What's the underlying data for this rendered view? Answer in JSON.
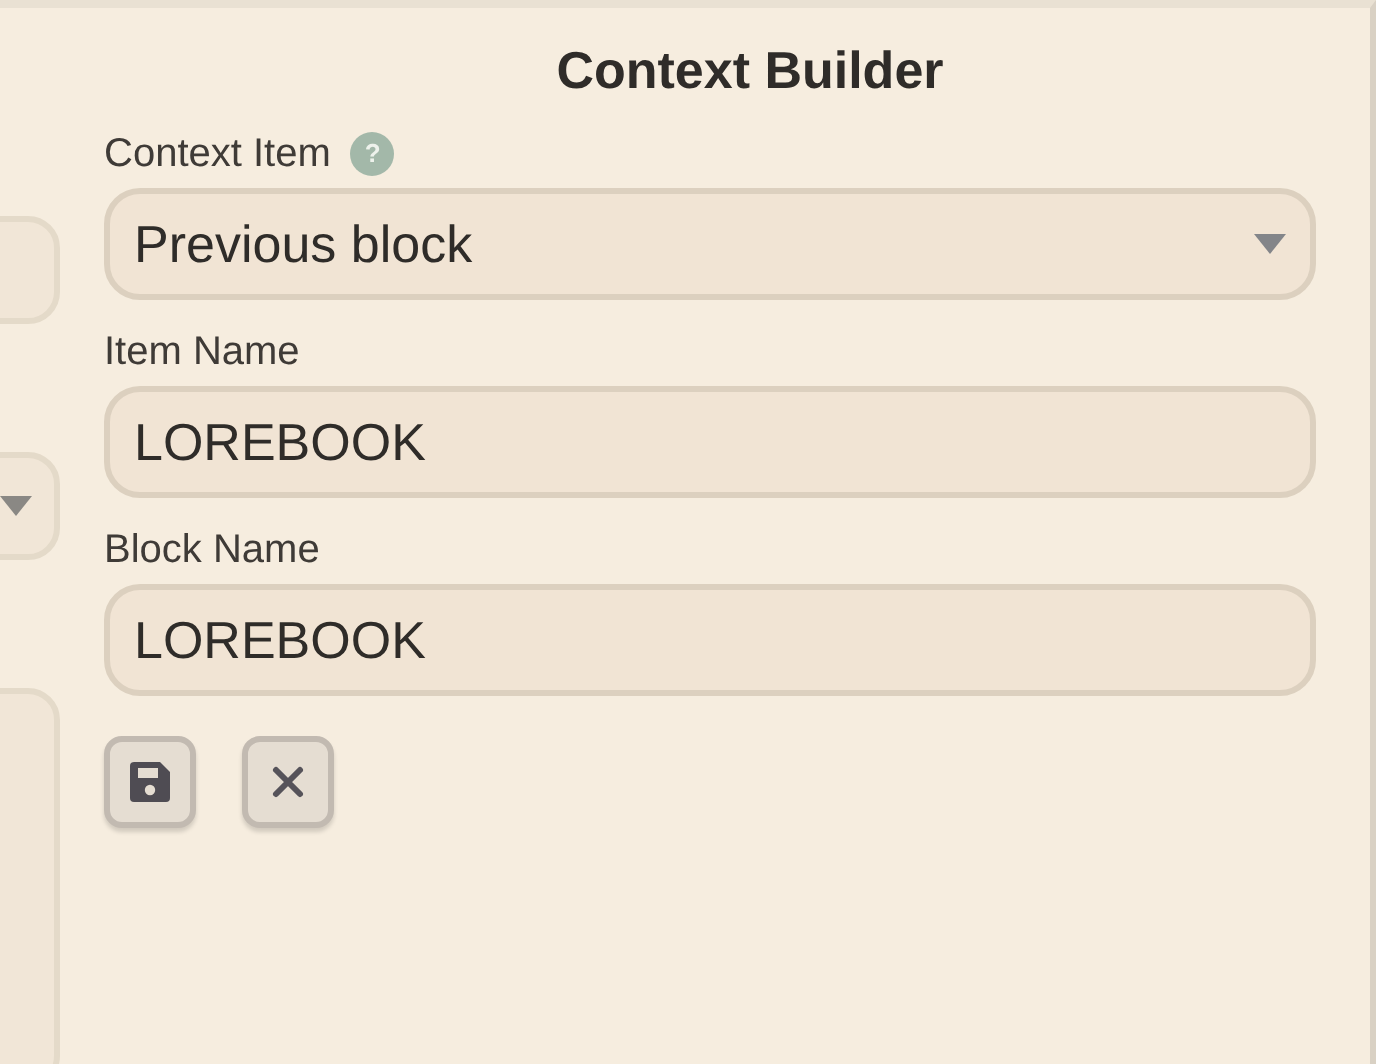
{
  "dialog": {
    "title": "Context Builder",
    "fields": [
      {
        "kind": "select",
        "label": "Context Item",
        "help": "?",
        "value": "Previous block"
      },
      {
        "kind": "text",
        "label": "Item Name",
        "value": "LOREBOOK"
      },
      {
        "kind": "text",
        "label": "Block Name",
        "value": "LOREBOOK"
      }
    ],
    "buttons": [
      {
        "kind": "save"
      },
      {
        "kind": "cancel"
      }
    ]
  }
}
